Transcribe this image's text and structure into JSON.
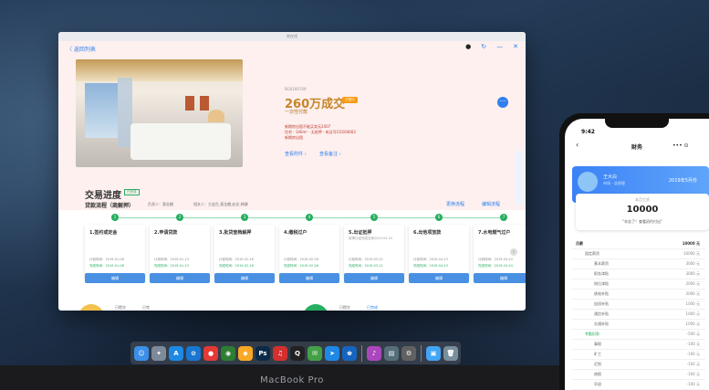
{
  "device": {
    "label": "MacBook Pro"
  },
  "window": {
    "title": "房在线",
    "back_label": "〈 返回列表",
    "icons": [
      "avatar-icon",
      "refresh-icon",
      "minimize-icon",
      "close-icon"
    ]
  },
  "deal": {
    "id": "BG0160709",
    "price": "260万成交",
    "tag": "已签约",
    "payment": "一次性付款",
    "line1": "新期房出租不能买卖无2407",
    "line2": "住宅 · 140m² · 无抵押 · 有证号CO204663",
    "line3": "新期房出租",
    "link1": "查看附件 ›",
    "link2": "查看备注 ›"
  },
  "progress": {
    "title": "交易进度",
    "status": "已完成",
    "flow_name": "贷款流程（商解押）",
    "responsible": "负责人：莫金麒",
    "related": "相关人：方益生,莫金麒,赵花,韩静",
    "change_flow": "更换流程",
    "edit_flow": "编辑流程",
    "steps": [
      {
        "num": "1",
        "title": "1.签约或定金",
        "note": "",
        "plan": "计划时间：2019-01-08",
        "done": "完成时间：2019-01-08",
        "btn": "编辑"
      },
      {
        "num": "2",
        "title": "2.申请贷款",
        "note": "",
        "plan": "计划时间：2019-01-13",
        "done": "完成时间：2019-01-13",
        "btn": "编辑"
      },
      {
        "num": "3",
        "title": "3.批贷查档解押",
        "note": "",
        "plan": "计划时间：2019-02-16",
        "done": "完成时间：2019-02-16",
        "btn": "编辑"
      },
      {
        "num": "4",
        "title": "4.缴税过户",
        "note": "",
        "plan": "计划时间：2019-02-26",
        "done": "完成时间：2019-02-26",
        "btn": "编辑"
      },
      {
        "num": "5",
        "title": "5.出证抵押",
        "note": "按揭已经完成交房2019.04.20",
        "plan": "计划时间：2019-03-21",
        "done": "完成时间：2019-03-21",
        "btn": "编辑"
      },
      {
        "num": "6",
        "title": "6.出他项放款",
        "note": "",
        "plan": "计划时间：2019-04-23",
        "done": "完成时间：2019-04-23",
        "btn": "编辑"
      },
      {
        "num": "7",
        "title": "7.水电燃气过户",
        "note": "",
        "plan": "计划时间：2019-04-24",
        "done": "完成时间：2019-04-24",
        "btn": "编辑"
      }
    ],
    "peek1": "已提交",
    "peek2": "已完",
    "peek3": "已提交",
    "peek4": "已完成"
  },
  "dock": {
    "apps": [
      {
        "name": "finder-icon",
        "glyph": "☺",
        "color": "#3b8fe8"
      },
      {
        "name": "launchpad-icon",
        "glyph": "✦",
        "color": "#7d8a99"
      },
      {
        "name": "app-store-icon",
        "glyph": "A",
        "color": "#1e88e5"
      },
      {
        "name": "safari-icon",
        "glyph": "⊘",
        "color": "#1976d2"
      },
      {
        "name": "chrome-icon",
        "glyph": "●",
        "color": "#e53935"
      },
      {
        "name": "wechat-work-icon",
        "glyph": "◉",
        "color": "#2e7d32"
      },
      {
        "name": "sketch-icon",
        "glyph": "◆",
        "color": "#f9a825"
      },
      {
        "name": "photoshop-icon",
        "glyph": "Ps",
        "color": "#0b2a4a"
      },
      {
        "name": "netease-music-icon",
        "glyph": "♫",
        "color": "#d32f2f"
      },
      {
        "name": "qq-icon",
        "glyph": "Q",
        "color": "#222"
      },
      {
        "name": "wechat-icon",
        "glyph": "✉",
        "color": "#43a047"
      },
      {
        "name": "dingtalk-icon",
        "glyph": "➤",
        "color": "#1e88e5"
      },
      {
        "name": "contacts-icon",
        "glyph": "♚",
        "color": "#1565c0"
      },
      {
        "name": "sep",
        "glyph": "",
        "color": ""
      },
      {
        "name": "itunes-icon",
        "glyph": "♪",
        "color": "#ab47bc"
      },
      {
        "name": "preview-icon",
        "glyph": "▤",
        "color": "#546e7a"
      },
      {
        "name": "system-prefs-icon",
        "glyph": "⚙",
        "color": "#616161"
      },
      {
        "name": "sep",
        "glyph": "",
        "color": ""
      },
      {
        "name": "downloads-icon",
        "glyph": "▣",
        "color": "#42a5f5"
      },
      {
        "name": "trash-icon",
        "glyph": "🗑",
        "color": "#78909c"
      }
    ]
  },
  "phone": {
    "time": "9:42",
    "title": "财务",
    "user_name": "王大白",
    "user_dept": "市场 · 总经理",
    "month": "2019年5月份",
    "card_label": "本月工资",
    "card_amount": "10000",
    "card_thanks": "\"辛苦了！查看初约付出\"",
    "rows": [
      {
        "k": "月薪",
        "v": "10000 元",
        "cls": "head"
      },
      {
        "k": "固定薪资",
        "v": "10000 元",
        "cls": "sub"
      },
      {
        "k": "基本薪资",
        "v": "3000 元",
        "cls": "sub2"
      },
      {
        "k": "职务津贴",
        "v": "3000 元",
        "cls": "sub2"
      },
      {
        "k": "岗位津贴",
        "v": "3000 元",
        "cls": "sub2"
      },
      {
        "k": "绩效补贴",
        "v": "3000 元",
        "cls": "sub2"
      },
      {
        "k": "加班补贴",
        "v": "1000 元",
        "cls": "sub2"
      },
      {
        "k": "通信补贴",
        "v": "1000 元",
        "cls": "sub2"
      },
      {
        "k": "交通补贴",
        "v": "1000 元",
        "cls": "sub2"
      },
      {
        "k": "考勤扣款",
        "v": "-500 元",
        "cls": "sub green"
      },
      {
        "k": "事假",
        "v": "-100 元",
        "cls": "sub2"
      },
      {
        "k": "旷工",
        "v": "-100 元",
        "cls": "sub2"
      },
      {
        "k": "迟到",
        "v": "-100 元",
        "cls": "sub2"
      },
      {
        "k": "病假",
        "v": "-100 元",
        "cls": "sub2"
      },
      {
        "k": "早退",
        "v": "-100 元",
        "cls": "sub2"
      }
    ]
  }
}
